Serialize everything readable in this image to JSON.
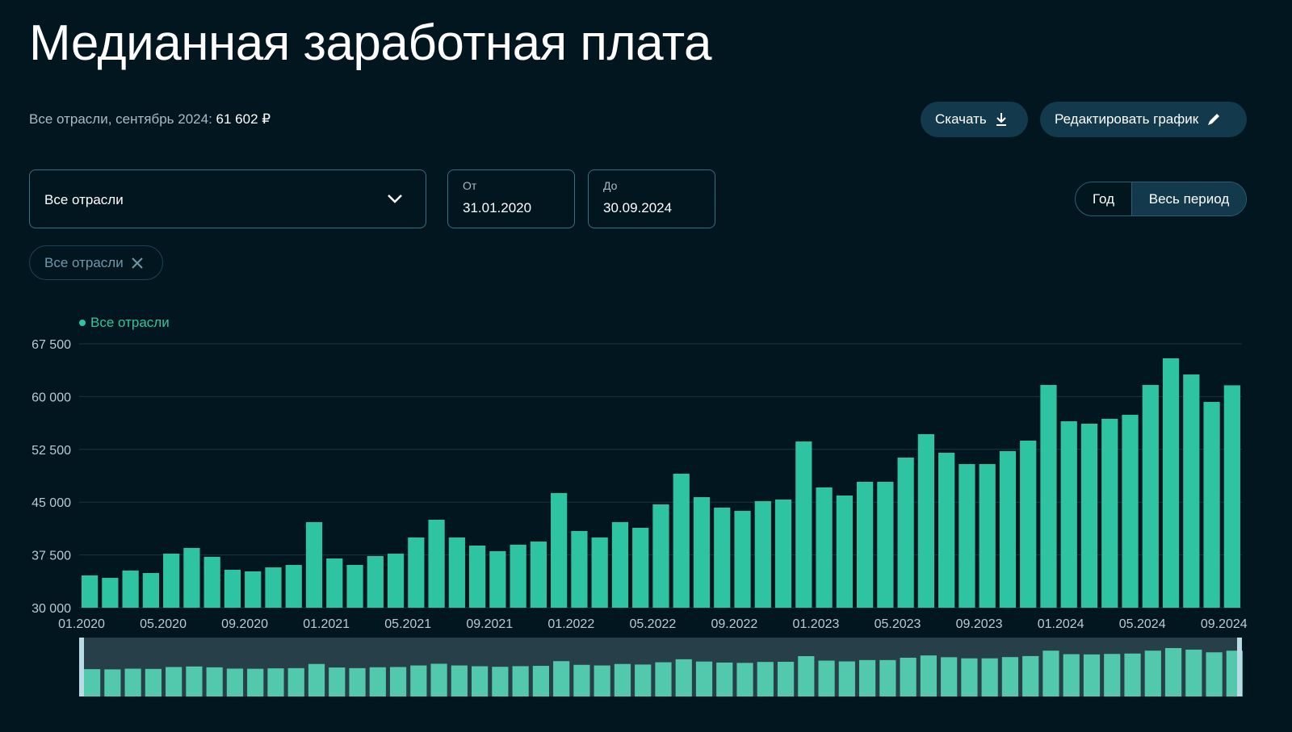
{
  "title": "Медианная заработная плата",
  "summary": {
    "label": "Все отрасли, сентябрь 2024:",
    "value": "61 602 ₽"
  },
  "buttons": {
    "download": "Скачать",
    "edit": "Редактировать график"
  },
  "filters": {
    "industry": "Все отрасли",
    "from_label": "От",
    "from_value": "31.01.2020",
    "to_label": "До",
    "to_value": "30.09.2024"
  },
  "period_toggle": {
    "options": [
      "Год",
      "Весь период"
    ],
    "selected": "Весь период"
  },
  "chip": "Все отрасли",
  "colors": {
    "bar": "#2ec4a2",
    "background": "#021620",
    "button": "#133a4c"
  },
  "chart_data": {
    "type": "bar",
    "title": "Медианная заработная плата",
    "legend": [
      "Все отрасли"
    ],
    "legend_position": "top-left",
    "ylim": [
      30000,
      67500
    ],
    "yticks": [
      30000,
      37500,
      45000,
      52500,
      60000,
      67500
    ],
    "ytick_labels": [
      "30 000",
      "37 500",
      "45 000",
      "52 500",
      "60 000",
      "67 500"
    ],
    "xtick_labels": [
      "01.2020",
      "05.2020",
      "09.2020",
      "01.2021",
      "05.2021",
      "09.2021",
      "01.2022",
      "05.2022",
      "09.2022",
      "01.2023",
      "05.2023",
      "09.2023",
      "01.2024",
      "05.2024",
      "09.2024"
    ],
    "grid": true,
    "series": [
      {
        "name": "Все отрасли",
        "values": [
          34590,
          34240,
          35280,
          34930,
          37680,
          38490,
          37230,
          35390,
          35160,
          35730,
          36080,
          42160,
          37000,
          36080,
          37340,
          37680,
          39980,
          42500,
          39980,
          38830,
          38030,
          38950,
          39400,
          46290,
          40900,
          39980,
          42160,
          41350,
          44680,
          49040,
          45710,
          44220,
          43760,
          45140,
          45370,
          53620,
          47090,
          45940,
          47890,
          47890,
          51330,
          54660,
          52020,
          50410,
          50410,
          52250,
          53740,
          61650,
          56490,
          56150,
          56840,
          57410,
          61650,
          65440,
          63140,
          59240,
          61602
        ]
      }
    ]
  }
}
